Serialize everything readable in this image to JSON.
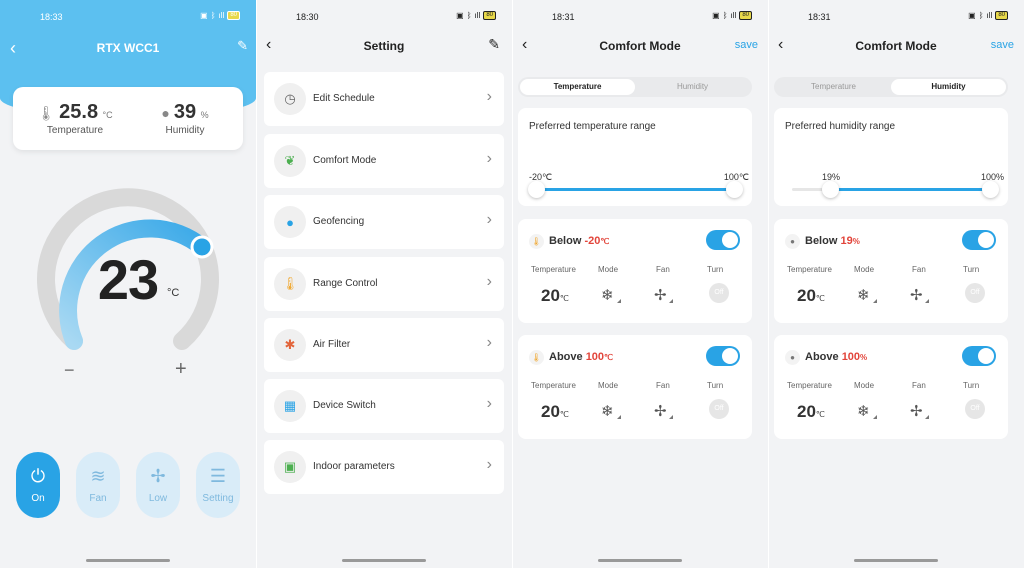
{
  "colors": {
    "accent": "#29a3e5",
    "hero": "#5cc0f0",
    "alert": "#e2453b",
    "background": "#f2f3f5"
  },
  "screen1": {
    "time": "18:33",
    "battery": "80",
    "title": "RTX WCC1",
    "temperature": {
      "value": "25.8",
      "unit": "°C",
      "label": "Temperature",
      "icon": "thermometer-icon"
    },
    "humidity": {
      "value": "39",
      "unit": "%",
      "label": "Humidity",
      "icon": "droplet-icon"
    },
    "setpoint": {
      "value": "23",
      "unit": "°C"
    },
    "minus": "−",
    "plus": "+",
    "controls": [
      {
        "label": "On",
        "icon": "power-icon",
        "active": true
      },
      {
        "label": "Fan",
        "icon": "wind-icon",
        "active": false
      },
      {
        "label": "Low",
        "icon": "fan-icon",
        "active": false
      },
      {
        "label": "Setting",
        "icon": "sliders-icon",
        "active": false
      }
    ]
  },
  "screen2": {
    "time": "18:30",
    "battery": "80",
    "title": "Setting",
    "items": [
      {
        "label": "Edit Schedule",
        "icon": "clock-icon"
      },
      {
        "label": "Comfort Mode",
        "icon": "leaf-icon"
      },
      {
        "label": "Geofencing",
        "icon": "location-pin-icon"
      },
      {
        "label": "Range Control",
        "icon": "thermometer-icon"
      },
      {
        "label": "Air Filter",
        "icon": "air-filter-icon"
      },
      {
        "label": "Device Switch",
        "icon": "device-switch-icon"
      },
      {
        "label": "Indoor parameters",
        "icon": "monitor-chart-icon"
      }
    ]
  },
  "screen3": {
    "time": "18:31",
    "battery": "80",
    "title": "Comfort Mode",
    "save": "save",
    "tabs": [
      "Temperature",
      "Humidity"
    ],
    "active_tab": 0,
    "range_title": "Preferred temperature range",
    "range_min": "-20℃",
    "range_max": "100℃",
    "range_low_fraction": 0.0,
    "range_high_fraction": 1.0,
    "rules": [
      {
        "prefix": "Below",
        "value": "-20",
        "unit": "℃",
        "col_headers": [
          "Temperature",
          "Mode",
          "Fan",
          "Turn"
        ],
        "temp": "20",
        "temp_unit": "℃",
        "turn": "Off",
        "enabled": true
      },
      {
        "prefix": "Above",
        "value": "100",
        "unit": "℃",
        "col_headers": [
          "Temperature",
          "Mode",
          "Fan",
          "Turn"
        ],
        "temp": "20",
        "temp_unit": "℃",
        "turn": "Off",
        "enabled": true
      }
    ]
  },
  "screen4": {
    "time": "18:31",
    "battery": "80",
    "title": "Comfort Mode",
    "save": "save",
    "tabs": [
      "Temperature",
      "Humidity"
    ],
    "active_tab": 1,
    "range_title": "Preferred humidity range",
    "range_min": "19%",
    "range_max": "100%",
    "range_low_fraction": 0.19,
    "range_high_fraction": 1.0,
    "rules": [
      {
        "prefix": "Below",
        "value": "19",
        "unit": "%",
        "col_headers": [
          "Temperature",
          "Mode",
          "Fan",
          "Turn"
        ],
        "temp": "20",
        "temp_unit": "℃",
        "turn": "Off",
        "enabled": true
      },
      {
        "prefix": "Above",
        "value": "100",
        "unit": "%",
        "col_headers": [
          "Temperature",
          "Mode",
          "Fan",
          "Turn"
        ],
        "temp": "20",
        "temp_unit": "℃",
        "turn": "Off",
        "enabled": true
      }
    ]
  }
}
